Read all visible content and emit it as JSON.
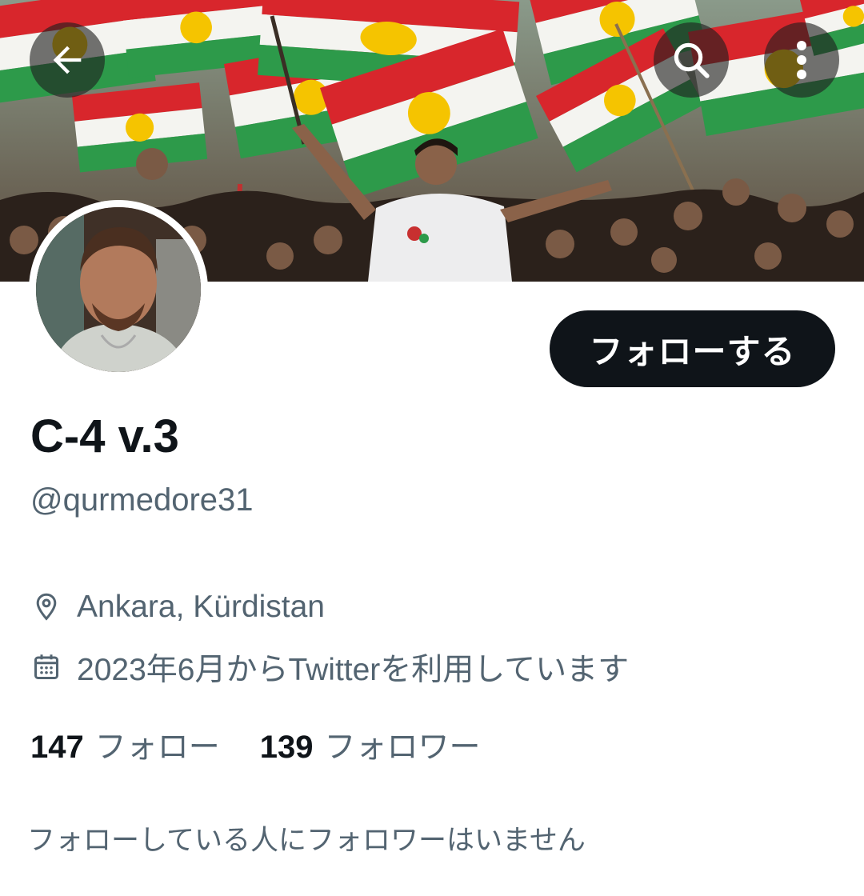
{
  "profile": {
    "display_name": "C-4 v.3",
    "handle": "@qurmedore31",
    "location": "Ankara, Kürdistan",
    "joined": "2023年6月からTwitterを利用しています",
    "follow_button_label": "フォローする",
    "following_count": "147",
    "following_label": "フォロー",
    "followers_count": "139",
    "followers_label": "フォロワー",
    "mutual_notice": "フォローしている人にフォロワーはいません"
  },
  "icons": {
    "back": "arrow-left-icon",
    "search": "search-icon",
    "more": "vertical-ellipsis-icon",
    "location": "location-pin-icon",
    "calendar": "calendar-icon"
  },
  "colors": {
    "primary_text": "#0f1419",
    "secondary_text": "#536471",
    "button_bg": "#0f1419",
    "flag_red": "#d8262c",
    "flag_green": "#2d9a4a",
    "flag_sun": "#f5c400"
  }
}
